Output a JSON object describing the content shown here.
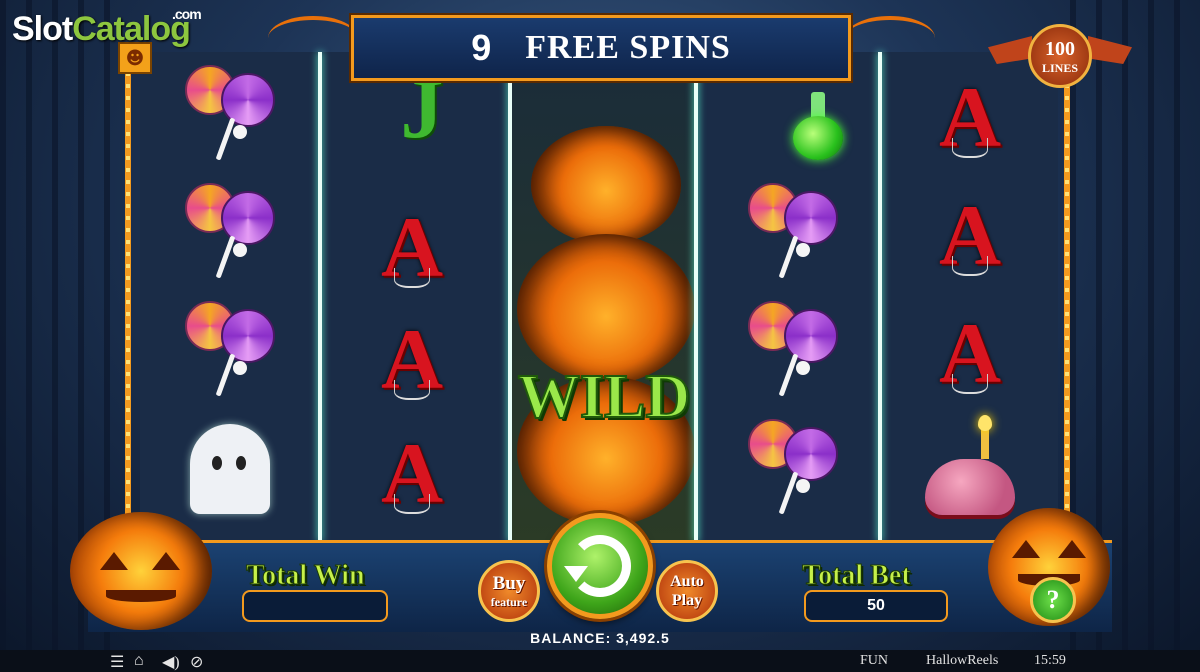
{
  "watermark": {
    "part1": "Slot",
    "part2": "Catalog",
    "suffix": ".com"
  },
  "banner": {
    "count": "9",
    "label": "FREE SPINS"
  },
  "lines_badge": {
    "value": "100",
    "label": "LINES"
  },
  "reels": {
    "col1": [
      "lollipop",
      "lollipop",
      "lollipop",
      "ghost"
    ],
    "col2": [
      "J",
      "A",
      "A",
      "A"
    ],
    "col3": [
      "pumpkin-wild"
    ],
    "col4": [
      "potion",
      "lollipop",
      "lollipop",
      "lollipop"
    ],
    "col5": [
      "A",
      "A",
      "A",
      "brain"
    ],
    "wild_label": "WILD"
  },
  "controls": {
    "total_win_label": "Total Win",
    "total_win_value": "",
    "buy_label_1": "Buy",
    "buy_label_2": "feature",
    "auto_label_1": "Auto",
    "auto_label_2": "Play",
    "total_bet_label": "Total Bet",
    "total_bet_value": "50",
    "help_label": "?"
  },
  "balance": {
    "text": "BALANCE: 3,492.5"
  },
  "statusbar": {
    "icons": [
      "menu-icon",
      "home-icon",
      "sound-icon",
      "turbo-icon"
    ],
    "mode": "FUN",
    "game_name": "HallowReels",
    "time": "15:59"
  },
  "colors": {
    "frame": "#f39a1e",
    "accent_green": "#c6f04a",
    "panel": "#1b4272"
  }
}
